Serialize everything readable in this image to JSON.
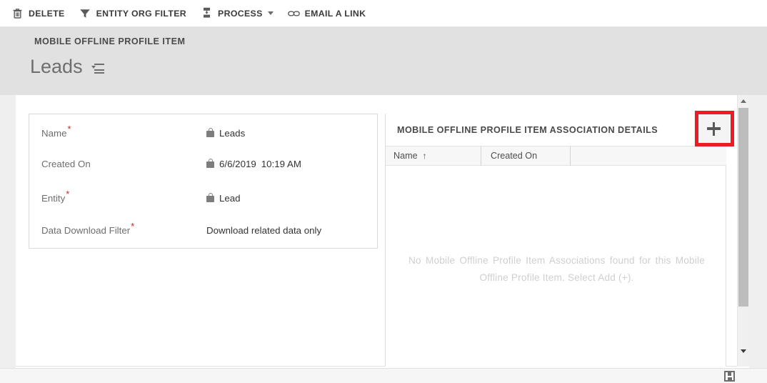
{
  "commandbar": {
    "items": [
      {
        "icon": "trash-icon",
        "label": "DELETE",
        "has_caret": false
      },
      {
        "icon": "filter-icon",
        "label": "ENTITY ORG FILTER",
        "has_caret": false
      },
      {
        "icon": "process-icon",
        "label": "PROCESS",
        "has_caret": true
      },
      {
        "icon": "link-icon",
        "label": "EMAIL A LINK",
        "has_caret": false
      }
    ]
  },
  "header": {
    "breadcrumb": "MOBILE OFFLINE PROFILE ITEM",
    "record_title": "Leads",
    "title_menu_icon": "chevron-down-list-icon"
  },
  "form": {
    "fields": [
      {
        "label": "Name",
        "required": true,
        "locked": true,
        "value": "Leads"
      },
      {
        "label": "Created On",
        "required": false,
        "locked": true,
        "value_date": "6/6/2019",
        "value_time": "10:19 AM"
      },
      {
        "label": "Entity",
        "required": true,
        "locked": true,
        "value": "Lead"
      },
      {
        "label": "Data Download Filter",
        "required": true,
        "locked": false,
        "value": "Download related data only"
      }
    ],
    "required_marker": "*"
  },
  "subgrid": {
    "title": "MOBILE OFFLINE PROFILE ITEM ASSOCIATION DETAILS",
    "add_button": {
      "icon": "plus-icon",
      "label": "+"
    },
    "columns": [
      {
        "label": "Name",
        "sort": "ascending",
        "sort_glyph": "↑"
      },
      {
        "label": "Created On",
        "sort": "none",
        "sort_glyph": ""
      },
      {
        "label": "",
        "sort": "none",
        "sort_glyph": ""
      }
    ],
    "rows": [],
    "empty_message": "No Mobile Offline Profile Item Associations found for this Mobile Offline Profile Item. Select Add (+)."
  },
  "scrollbar": {
    "up_arrow_icon": "caret-up-icon",
    "down_arrow_icon": "caret-down-icon"
  },
  "statusbar": {
    "save_icon": "save-floppy-icon"
  },
  "highlight": {
    "color": "#ed1c24",
    "target": "add-button"
  },
  "colors": {
    "header_background": "#e1e1e1",
    "canvas_background": "#ffffff",
    "grid_header_background": "#f7f7f7",
    "required_asterisk": "#c3272b",
    "empty_message_text": "#cfcfcf",
    "scrollbar_thumb": "#bdbdbd"
  }
}
